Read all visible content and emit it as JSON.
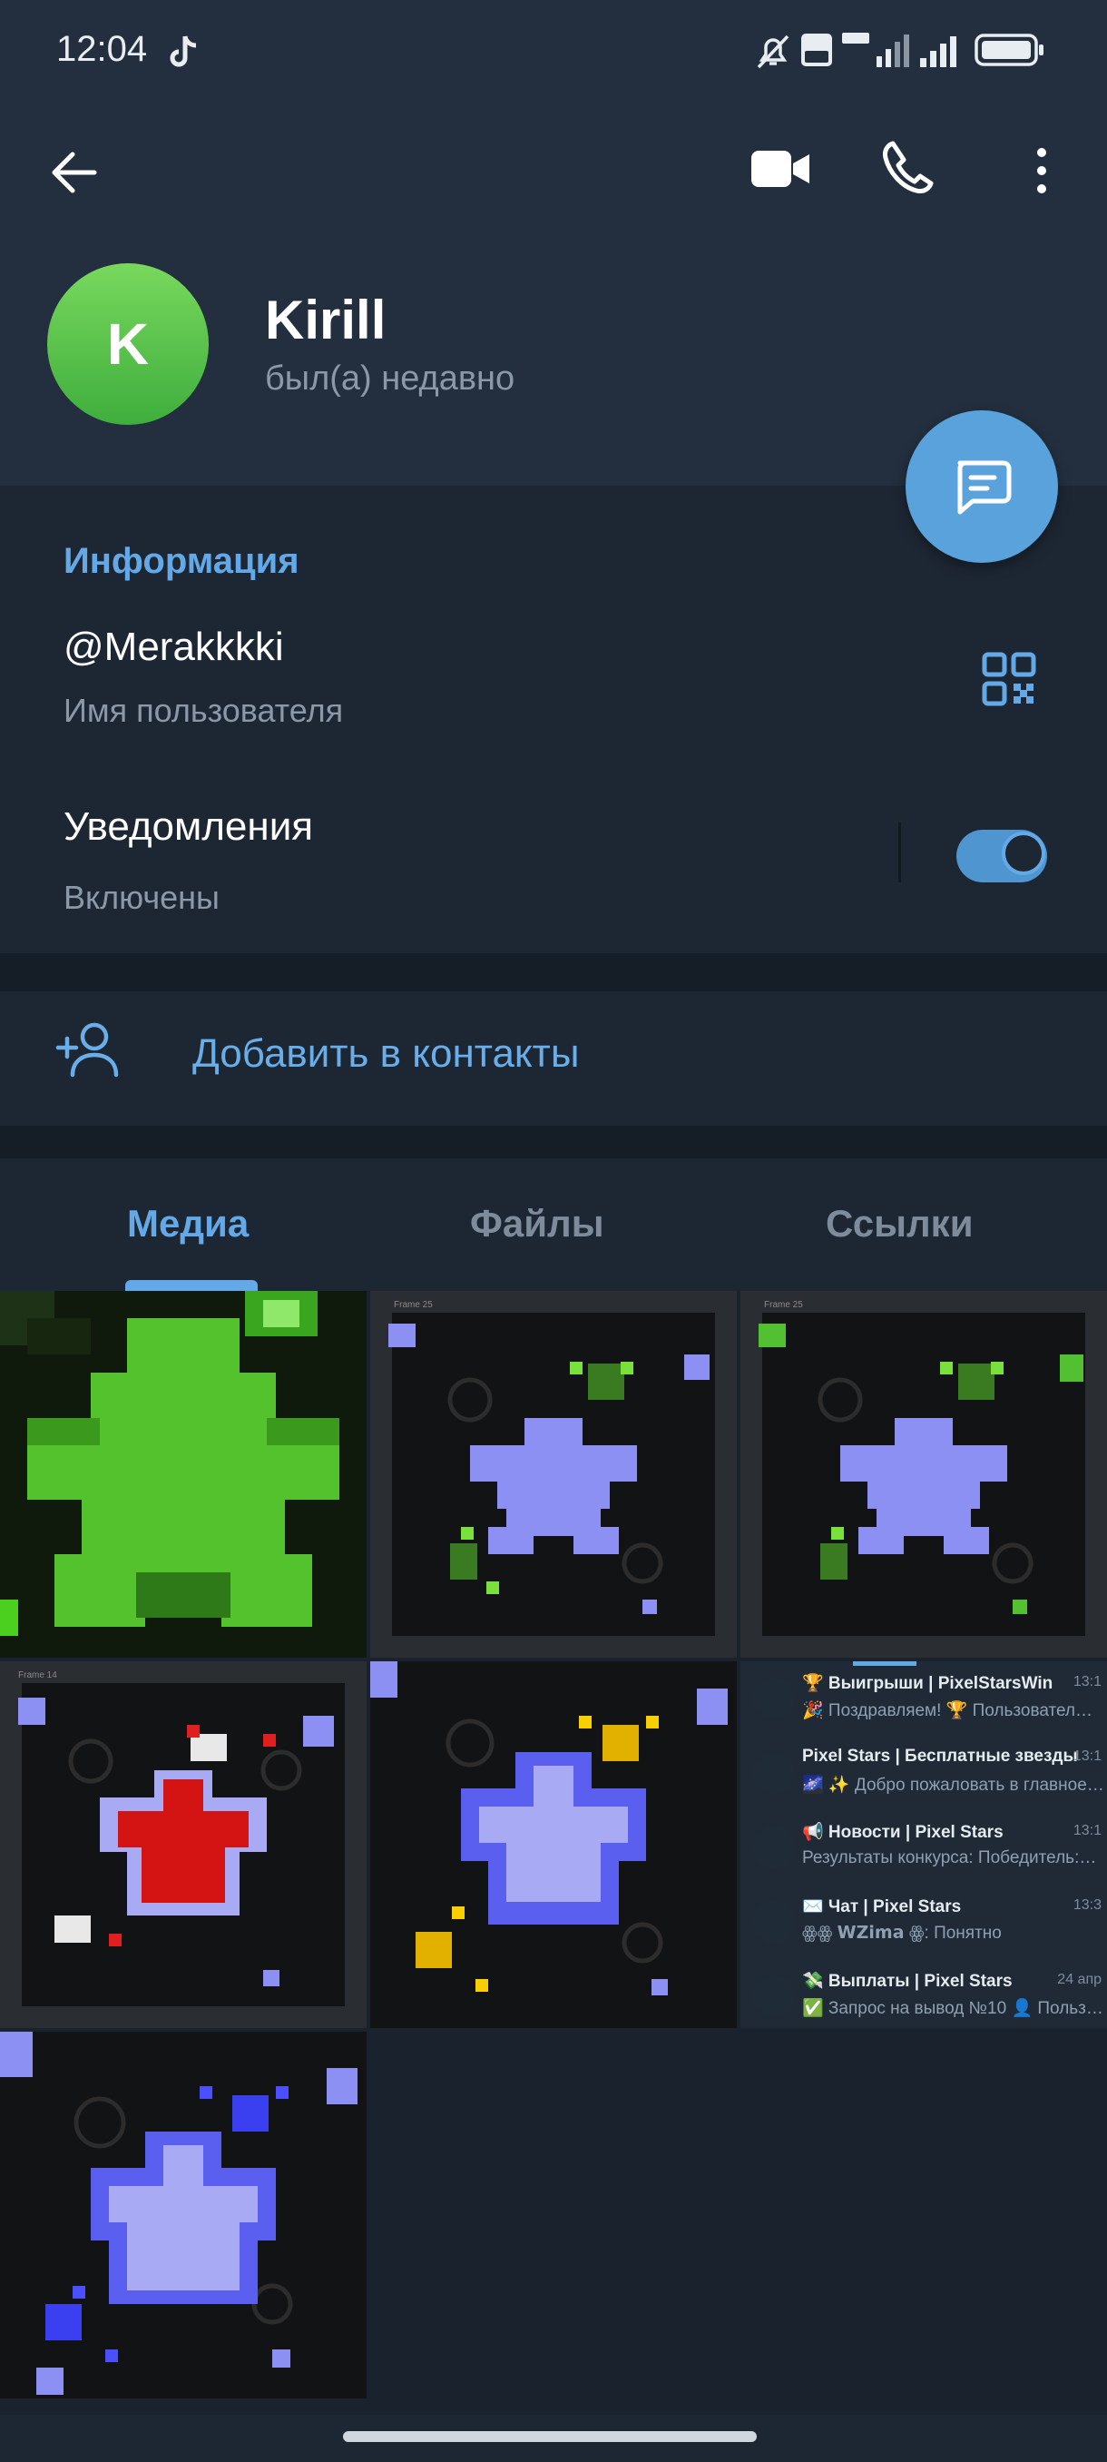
{
  "status_bar": {
    "time": "12:04"
  },
  "profile": {
    "avatar_letter": "K",
    "name": "Kirill",
    "last_seen": "был(а) недавно"
  },
  "info": {
    "section_title": "Информация",
    "username": "@Merakkkki",
    "username_caption": "Имя пользователя",
    "notifications_label": "Уведомления",
    "notifications_state": "Включены",
    "notifications_enabled": true
  },
  "actions": {
    "add_contact": "Добавить в контакты"
  },
  "tabs": [
    {
      "label": "Медиа",
      "active": true
    },
    {
      "label": "Файлы",
      "active": false
    },
    {
      "label": "Ссылки",
      "active": false
    }
  ],
  "media": {
    "frame_labels": [
      "Frame 25",
      "Frame 25",
      "Frame 14"
    ],
    "chat_list_preview": [
      {
        "title": "🏆 Выигрыши | PixelStarsWin",
        "preview": "🎉 Поздравляем! 🏆 Пользовател…",
        "time": "13:1"
      },
      {
        "title": "Pixel Stars | Бесплатные звезды",
        "preview": "🌌 ✨ Добро пожаловать в главное…",
        "time": "13:1"
      },
      {
        "title": "📢 Новости | Pixel Stars",
        "preview": "Результаты конкурса: Победитель:…",
        "time": "13:1"
      },
      {
        "title": "✉️ Чат | Pixel Stars",
        "preview": "ꙮꙮ 𝗪𝗭𝗶𝗺𝗮 ꙮ: Понятно",
        "time": "13:3"
      },
      {
        "title": "💸 Выплаты | Pixel Stars",
        "preview": "✅ Запрос на вывод №10 👤 Польз…",
        "time": "24 апр"
      }
    ]
  },
  "colors": {
    "accent": "#63a9e8",
    "header_bg": "#232f3e",
    "body_bg": "#1d2733",
    "avatar": "#5cc64a"
  }
}
